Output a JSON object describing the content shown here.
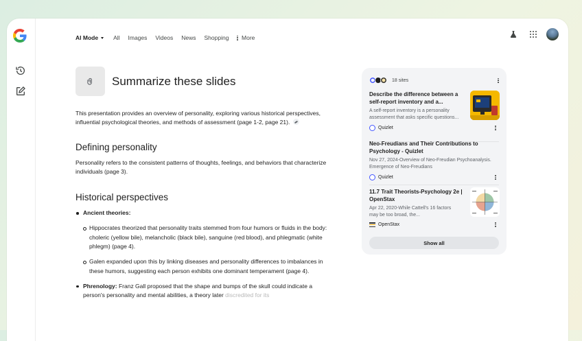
{
  "nav": {
    "items": [
      {
        "label": "AI Mode",
        "active": true
      },
      {
        "label": "All"
      },
      {
        "label": "Images"
      },
      {
        "label": "Videos"
      },
      {
        "label": "News"
      },
      {
        "label": "Shopping"
      }
    ],
    "more": "More"
  },
  "query": {
    "attachment_icon": "paperclip-icon",
    "text": "Summarize these slides"
  },
  "answer": {
    "intro": "This presentation provides an overview of personality, exploring various historical perspectives, influential psychological theories, and methods of assessment (page 1-2, page 21).",
    "section1": {
      "heading": "Defining personality",
      "text": "Personality refers to the consistent patterns of thoughts, feelings, and behaviors that characterize individuals (page 3)."
    },
    "section2": {
      "heading": "Historical perspectives",
      "bullet1": {
        "label": "Ancient theories:",
        "sub": [
          "Hippocrates theorized that personality traits stemmed from four humors or fluids in the body: choleric (yellow bile), melancholic (black bile), sanguine (red blood), and phlegmatic (white phlegm) (page 4).",
          "Galen expanded upon this by linking diseases and personality differences to imbalances in these humors, suggesting each person exhibits one dominant temperament (page 4)."
        ]
      },
      "bullet2": {
        "label": "Phrenology:",
        "text": "Franz Gall proposed that the shape and bumps of the skull could indicate a person's personality and mental abilities, a theory later",
        "faded": "discredited for its"
      }
    }
  },
  "sources": {
    "count": "18 sites",
    "items": [
      {
        "title": "Describe the difference between a self-report inventory and a...",
        "snippet": "A self-report inventory is a personality assessment that asks specific questions...",
        "site": "Quizlet"
      },
      {
        "title": "Neo-Freudians and Their Contributions to Psychology - Quizlet",
        "snippet": "Nov 27, 2024-Overview of Neo-Freudian Psychoanalysis. Emergence of Neo-Freudians",
        "site": "Quizlet"
      },
      {
        "title": "11.7 Trait Theorists-Psychology 2e | OpenStax",
        "snippet": "Apr 22, 2020-While Cattell's 16 factors may be too broad, the...",
        "site": "OpenStax"
      }
    ],
    "show_all": "Show all"
  },
  "colors": {
    "quizlet": "#4255ff",
    "openstax_accent": "#f2a900",
    "card_bg": "#f3f4f6"
  }
}
